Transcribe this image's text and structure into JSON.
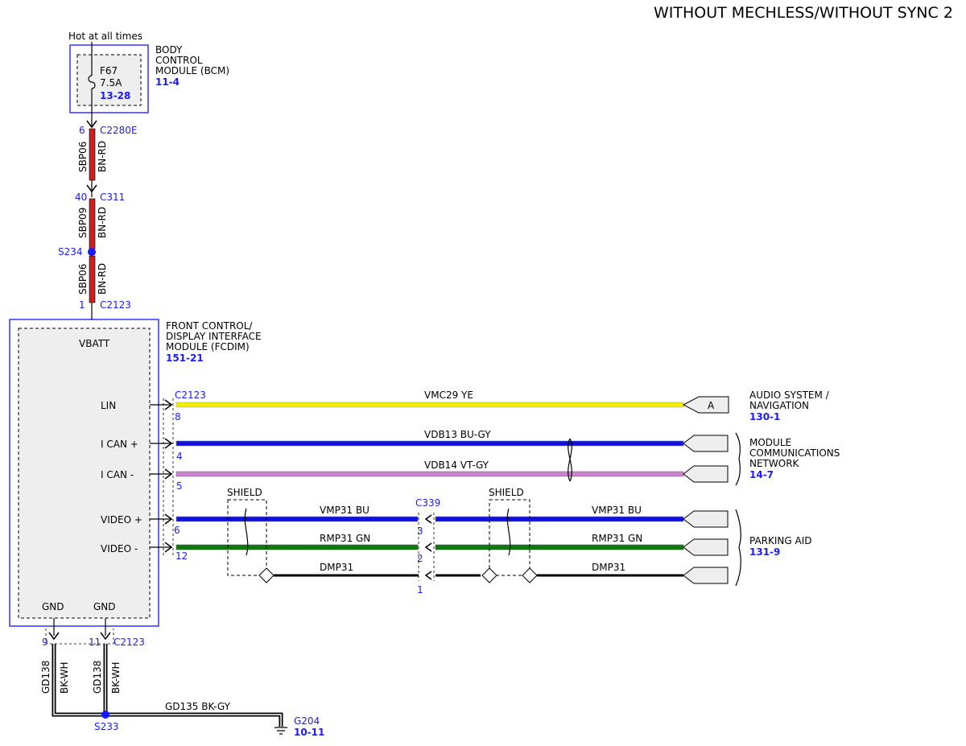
{
  "title": "WITHOUT MECHLESS/WITHOUT SYNC 2",
  "hot_label": "Hot at all times",
  "bcm": {
    "name_lines": [
      "BODY",
      "CONTROL",
      "MODULE (BCM)"
    ],
    "ref": "11-4",
    "fuse": {
      "name": "F67",
      "rating": "7.5A",
      "ref": "13-28"
    }
  },
  "fcdim": {
    "name_lines": [
      "FRONT CONTROL/",
      "DISPLAY INTERFACE",
      "MODULE (FCDIM)"
    ],
    "ref": "151-21",
    "pins": {
      "vbatt": "VBATT",
      "lin": "LIN",
      "ican_p": "I CAN +",
      "ican_m": "I CAN -",
      "video_p": "VIDEO +",
      "video_m": "VIDEO -",
      "gnd1": "GND",
      "gnd2": "GND"
    }
  },
  "power_path": [
    {
      "pin": "6",
      "connector": "C2280E",
      "circuit": "SBP06",
      "color": "BN-RD"
    },
    {
      "pin": "40",
      "connector": "C311",
      "circuit": "SBP09",
      "color": "BN-RD"
    },
    {
      "splice": "S234",
      "circuit": "SBP06",
      "color": "BN-RD"
    },
    {
      "pin": "1",
      "connector": "C2123"
    }
  ],
  "wires": [
    {
      "connector": "C2123",
      "pin": "8",
      "label": "VMC29  YE",
      "color": "#f2f000"
    },
    {
      "pin": "4",
      "label": "VDB13  BU-GY",
      "color": "#1010e0"
    },
    {
      "pin": "5",
      "label": "VDB14  VT-GY",
      "color": "#d080d0"
    },
    {
      "pin": "6",
      "label_left": "VMP31  BU",
      "connector_mid": "C339",
      "pin_mid": "3",
      "label_right": "VMP31  BU",
      "color": "#1010e0"
    },
    {
      "pin": "12",
      "label_left": "RMP31  GN",
      "pin_mid": "2",
      "label_right": "RMP31  GN",
      "color": "#0a7a0a"
    },
    {
      "label_left": "DMP31",
      "pin_mid": "1",
      "label_right": "DMP31",
      "color": "#000000"
    }
  ],
  "shield_label": "SHIELD",
  "destinations": [
    {
      "lines": [
        "AUDIO SYSTEM /",
        "NAVIGATION"
      ],
      "ref": "130-1",
      "flag": "A"
    },
    {
      "lines": [
        "MODULE",
        "COMMUNICATIONS",
        "NETWORK"
      ],
      "ref": "14-7"
    },
    {
      "lines": [
        "PARKING AID"
      ],
      "ref": "131-9"
    }
  ],
  "ground": {
    "pin1": "9",
    "pin2": "11",
    "connector": "C2123",
    "circuit1": "GD138",
    "color1": "BK-WH",
    "circuit2": "GD138",
    "color2": "BK-WH",
    "splice": "S233",
    "main": "GD135  BK-GY",
    "ground_point": "G204",
    "ref": "10-11"
  }
}
